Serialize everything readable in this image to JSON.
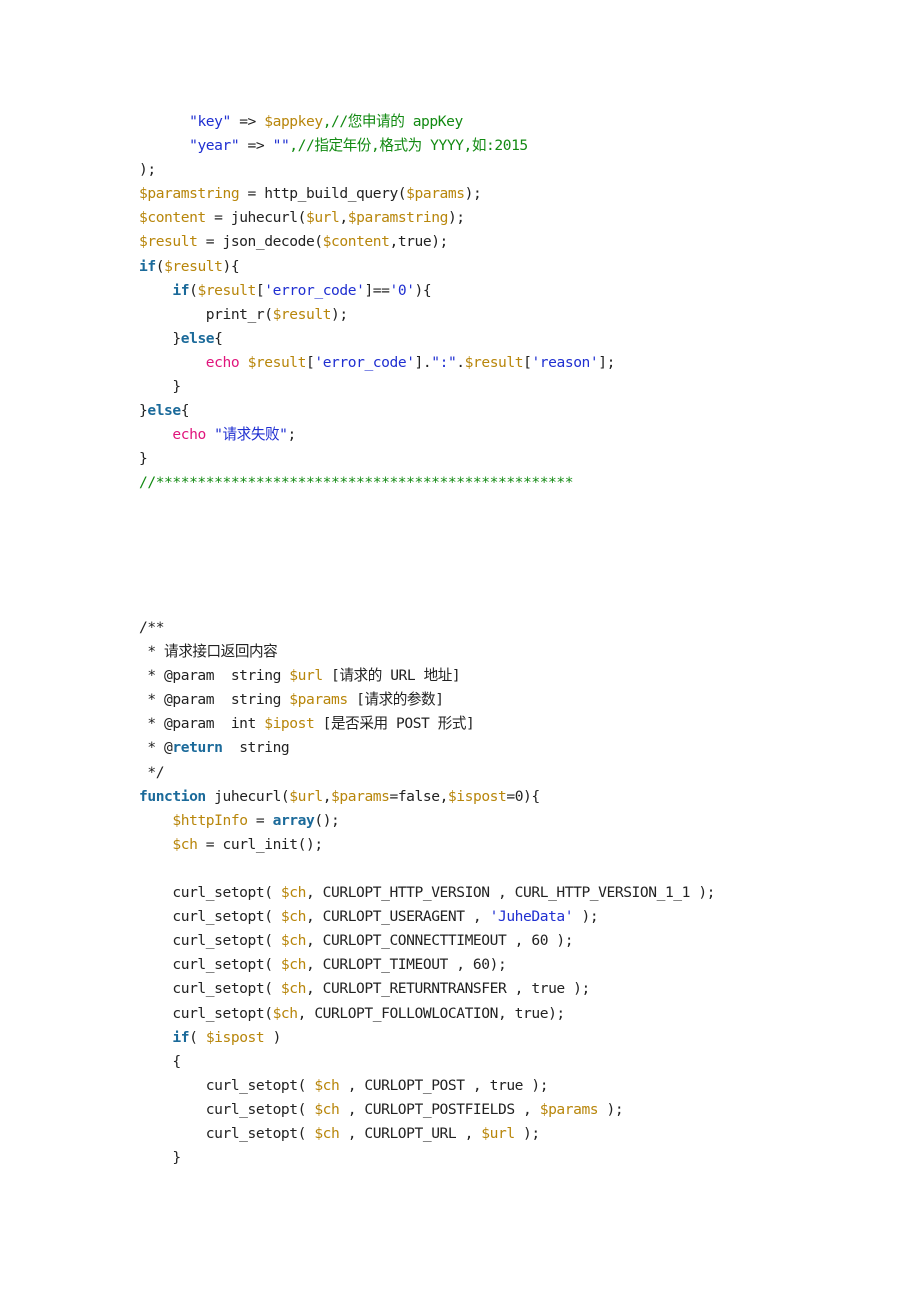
{
  "document": {
    "blocks": [
      {
        "name": "api-call-snippet",
        "lines": [
          [
            {
              "t": "      "
            },
            {
              "t": "\"key\"",
              "c": "str"
            },
            {
              "t": " => "
            },
            {
              "t": "$appkey",
              "c": "var"
            },
            {
              "t": ",//您申请的 appKey",
              "c": "cmt"
            }
          ],
          [
            {
              "t": "      "
            },
            {
              "t": "\"year\"",
              "c": "str"
            },
            {
              "t": " => "
            },
            {
              "t": "\"\"",
              "c": "str"
            },
            {
              "t": ",//指定年份,格式为 YYYY,如:2015",
              "c": "cmt"
            }
          ],
          [
            {
              "t": ");"
            }
          ],
          [
            {
              "t": "$paramstring",
              "c": "var"
            },
            {
              "t": " = http_build_query("
            },
            {
              "t": "$params",
              "c": "var"
            },
            {
              "t": ");"
            }
          ],
          [
            {
              "t": "$content",
              "c": "var"
            },
            {
              "t": " = juhecurl("
            },
            {
              "t": "$url",
              "c": "var"
            },
            {
              "t": ","
            },
            {
              "t": "$paramstring",
              "c": "var"
            },
            {
              "t": ");"
            }
          ],
          [
            {
              "t": "$result",
              "c": "var"
            },
            {
              "t": " = json_decode("
            },
            {
              "t": "$content",
              "c": "var"
            },
            {
              "t": ",true);"
            }
          ],
          [
            {
              "t": "if",
              "c": "kw"
            },
            {
              "t": "("
            },
            {
              "t": "$result",
              "c": "var"
            },
            {
              "t": "){"
            }
          ],
          [
            {
              "t": "    "
            },
            {
              "t": "if",
              "c": "kw"
            },
            {
              "t": "("
            },
            {
              "t": "$result",
              "c": "var"
            },
            {
              "t": "["
            },
            {
              "t": "'error_code'",
              "c": "str"
            },
            {
              "t": "]=="
            },
            {
              "t": "'0'",
              "c": "str"
            },
            {
              "t": "){"
            }
          ],
          [
            {
              "t": "        print_r("
            },
            {
              "t": "$result",
              "c": "var"
            },
            {
              "t": ");"
            }
          ],
          [
            {
              "t": "    }"
            },
            {
              "t": "else",
              "c": "kw"
            },
            {
              "t": "{"
            }
          ],
          [
            {
              "t": "        "
            },
            {
              "t": "echo",
              "c": "echo"
            },
            {
              "t": " "
            },
            {
              "t": "$result",
              "c": "var"
            },
            {
              "t": "["
            },
            {
              "t": "'error_code'",
              "c": "str"
            },
            {
              "t": "]."
            },
            {
              "t": "\":\"",
              "c": "str"
            },
            {
              "t": "."
            },
            {
              "t": "$result",
              "c": "var"
            },
            {
              "t": "["
            },
            {
              "t": "'reason'",
              "c": "str"
            },
            {
              "t": "];"
            }
          ],
          [
            {
              "t": "    }"
            }
          ],
          [
            {
              "t": "}"
            },
            {
              "t": "else",
              "c": "kw"
            },
            {
              "t": "{"
            }
          ],
          [
            {
              "t": "    "
            },
            {
              "t": "echo",
              "c": "echo"
            },
            {
              "t": " "
            },
            {
              "t": "\"请求失败\"",
              "c": "str"
            },
            {
              "t": ";"
            }
          ],
          [
            {
              "t": "}"
            }
          ],
          [
            {
              "t": "//**************************************************",
              "c": "cmt"
            }
          ]
        ]
      },
      {
        "name": "juhecurl-function",
        "lines": [
          [
            {
              "t": "/**",
              "c": "doc"
            }
          ],
          [
            {
              "t": " * 请求接口返回内容",
              "c": "doc"
            }
          ],
          [
            {
              "t": " * @param  string ",
              "c": "doc"
            },
            {
              "t": "$url",
              "c": "var"
            },
            {
              "t": " [请求的 URL 地址]",
              "c": "doc"
            }
          ],
          [
            {
              "t": " * @param  string ",
              "c": "doc"
            },
            {
              "t": "$params",
              "c": "var"
            },
            {
              "t": " [请求的参数]",
              "c": "doc"
            }
          ],
          [
            {
              "t": " * @param  int ",
              "c": "doc"
            },
            {
              "t": "$ipost",
              "c": "var"
            },
            {
              "t": " [是否采用 POST 形式]",
              "c": "doc"
            }
          ],
          [
            {
              "t": " * @",
              "c": "doc"
            },
            {
              "t": "return",
              "c": "kw"
            },
            {
              "t": "  string",
              "c": "doc"
            }
          ],
          [
            {
              "t": " */",
              "c": "doc"
            }
          ],
          [
            {
              "t": "function",
              "c": "kw"
            },
            {
              "t": " juhecurl("
            },
            {
              "t": "$url",
              "c": "var"
            },
            {
              "t": ","
            },
            {
              "t": "$params",
              "c": "var"
            },
            {
              "t": "=false,"
            },
            {
              "t": "$ispost",
              "c": "var"
            },
            {
              "t": "=0){"
            }
          ],
          [
            {
              "t": "    "
            },
            {
              "t": "$httpInfo",
              "c": "var"
            },
            {
              "t": " = "
            },
            {
              "t": "array",
              "c": "kw"
            },
            {
              "t": "();"
            }
          ],
          [
            {
              "t": "    "
            },
            {
              "t": "$ch",
              "c": "var"
            },
            {
              "t": " = curl_init();"
            }
          ],
          [
            {
              "t": ""
            }
          ],
          [
            {
              "t": "    curl_setopt( "
            },
            {
              "t": "$ch",
              "c": "var"
            },
            {
              "t": ", CURLOPT_HTTP_VERSION , CURL_HTTP_VERSION_1_1 );"
            }
          ],
          [
            {
              "t": "    curl_setopt( "
            },
            {
              "t": "$ch",
              "c": "var"
            },
            {
              "t": ", CURLOPT_USERAGENT , "
            },
            {
              "t": "'JuheData'",
              "c": "str"
            },
            {
              "t": " );"
            }
          ],
          [
            {
              "t": "    curl_setopt( "
            },
            {
              "t": "$ch",
              "c": "var"
            },
            {
              "t": ", CURLOPT_CONNECTTIMEOUT , 60 );"
            }
          ],
          [
            {
              "t": "    curl_setopt( "
            },
            {
              "t": "$ch",
              "c": "var"
            },
            {
              "t": ", CURLOPT_TIMEOUT , 60);"
            }
          ],
          [
            {
              "t": "    curl_setopt( "
            },
            {
              "t": "$ch",
              "c": "var"
            },
            {
              "t": ", CURLOPT_RETURNTRANSFER , true );"
            }
          ],
          [
            {
              "t": "    curl_setopt("
            },
            {
              "t": "$ch",
              "c": "var"
            },
            {
              "t": ", CURLOPT_FOLLOWLOCATION, true);"
            }
          ],
          [
            {
              "t": "    "
            },
            {
              "t": "if",
              "c": "kw"
            },
            {
              "t": "( "
            },
            {
              "t": "$ispost",
              "c": "var"
            },
            {
              "t": " )"
            }
          ],
          [
            {
              "t": "    {"
            }
          ],
          [
            {
              "t": "        curl_setopt( "
            },
            {
              "t": "$ch",
              "c": "var"
            },
            {
              "t": " , CURLOPT_POST , true );"
            }
          ],
          [
            {
              "t": "        curl_setopt( "
            },
            {
              "t": "$ch",
              "c": "var"
            },
            {
              "t": " , CURLOPT_POSTFIELDS , "
            },
            {
              "t": "$params",
              "c": "var"
            },
            {
              "t": " );"
            }
          ],
          [
            {
              "t": "        curl_setopt( "
            },
            {
              "t": "$ch",
              "c": "var"
            },
            {
              "t": " , CURLOPT_URL , "
            },
            {
              "t": "$url",
              "c": "var"
            },
            {
              "t": " );"
            }
          ],
          [
            {
              "t": "    }"
            }
          ]
        ]
      }
    ]
  },
  "colors": {
    "variable": "#b8860b",
    "string": "#1f2fd1",
    "keyword": "#1b6a9a",
    "echo": "#e0157c",
    "comment": "#128a12",
    "text": "#222222"
  }
}
